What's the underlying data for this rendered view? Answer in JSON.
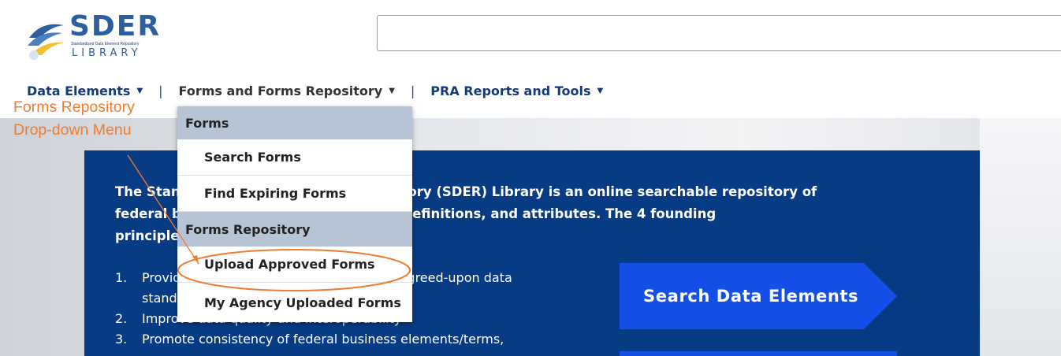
{
  "logo": {
    "title": "SDER",
    "subtitle": "Standardized Data Element Repository",
    "library": "LIBRARY"
  },
  "search": {
    "value": "",
    "placeholder": ""
  },
  "nav": {
    "items": [
      {
        "label": "Data Elements"
      },
      {
        "label": "Forms and Forms Repository"
      },
      {
        "label": "PRA Reports and Tools"
      }
    ],
    "separator": "|"
  },
  "dropdown": {
    "section_forms": "Forms",
    "search_forms": "Search Forms",
    "find_expiring_forms": "Find Expiring Forms",
    "section_forms_repository": "Forms Repository",
    "upload_approved_forms": "Upload Approved Forms",
    "my_agency_uploaded_forms": "My Agency Uploaded Forms"
  },
  "hero": {
    "intro_line1": "The Standardized Data Element Repository (SDER) Library is an online searchable repository of",
    "intro_line2": "federal business data elements/terms, definitions, and attributes. The 4 founding",
    "intro_line3": "principles of SDER are to:",
    "principles": [
      {
        "num": "1.",
        "line1": "Provide a central repository of common, agreed-upon data",
        "line2": "standards"
      },
      {
        "num": "2.",
        "line1": "Improve data quality and interoperability"
      },
      {
        "num": "3.",
        "line1": "Promote consistency of federal business elements/terms,"
      }
    ],
    "cta_label": "Search Data Elements"
  },
  "annotation": {
    "line1": "Forms Repository",
    "line2": "Drop-down Menu",
    "color": "#ED7D31"
  },
  "colors": {
    "nav_blue": "#163A78",
    "hero_panel": "#073B84",
    "cta": "#1450E8",
    "dropdown_header": "#B7C4D6"
  }
}
